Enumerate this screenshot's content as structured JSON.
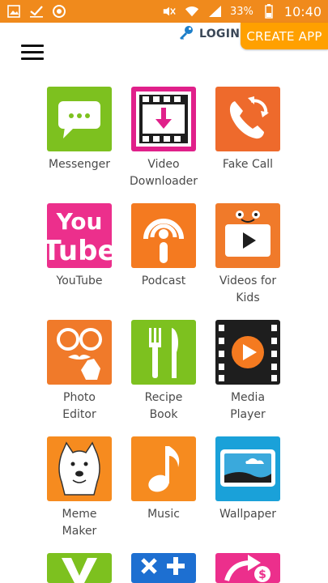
{
  "status_bar": {
    "battery_percent": "33%",
    "time": "10:40",
    "left_icons": [
      "gallery-icon",
      "check-icon",
      "target-icon"
    ],
    "right_icons": [
      "mute-icon",
      "wifi-icon",
      "signal-icon",
      "battery-icon"
    ]
  },
  "header": {
    "login_label": "LOGIN",
    "create_app_label": "CREATE APP"
  },
  "apps": [
    {
      "label": "Messenger",
      "icon": "messenger-icon"
    },
    {
      "label": "Video\nDownloader",
      "icon": "video-downloader-icon"
    },
    {
      "label": "Fake Call",
      "icon": "fake-call-icon"
    },
    {
      "label": "YouTube",
      "icon": "youtube-icon",
      "icon_text_1": "You",
      "icon_text_2": "Tube"
    },
    {
      "label": "Podcast",
      "icon": "podcast-icon"
    },
    {
      "label": "Videos for\nKids",
      "icon": "videos-for-kids-icon"
    },
    {
      "label": "Photo\nEditor",
      "icon": "photo-editor-icon"
    },
    {
      "label": "Recipe\nBook",
      "icon": "recipe-book-icon"
    },
    {
      "label": "Media\nPlayer",
      "icon": "media-player-icon"
    },
    {
      "label": "Meme\nMaker",
      "icon": "meme-maker-icon"
    },
    {
      "label": "Music",
      "icon": "music-icon"
    },
    {
      "label": "Wallpaper",
      "icon": "wallpaper-icon"
    }
  ],
  "colors": {
    "status_bar": "#f08a1c",
    "create_app": "#ffa000",
    "messenger": "#7dc11f",
    "video_downloader": "#e0208a",
    "fake_call": "#ee6a2c",
    "youtube": "#ec2f8c",
    "podcast": "#f47a20",
    "videos_for_kids": "#f07a2a",
    "photo_editor": "#f07a2a",
    "recipe_book": "#7dc11f",
    "media_player": "#1e1e1e",
    "meme_maker": "#f68b1f",
    "music": "#f68b1f",
    "wallpaper": "#1aa1d9"
  }
}
